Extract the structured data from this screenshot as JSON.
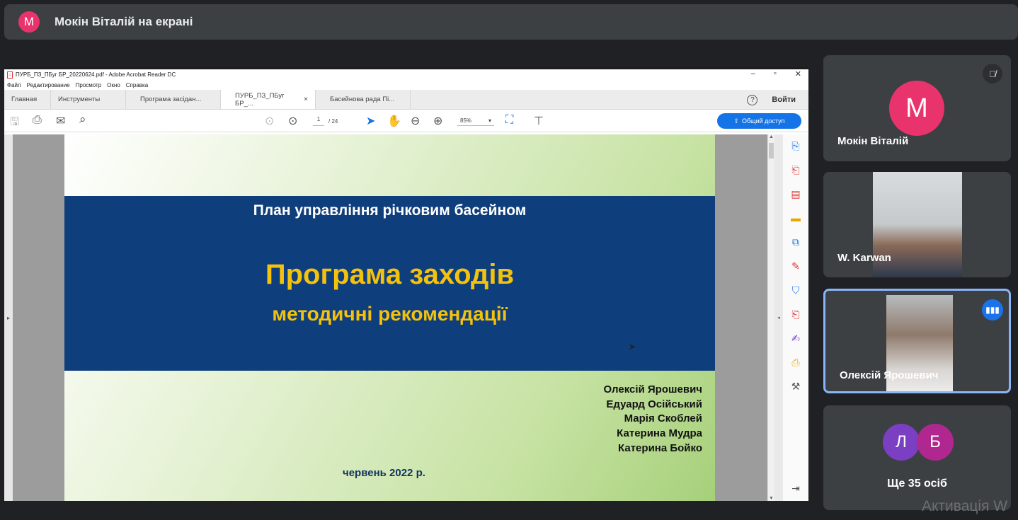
{
  "banner": {
    "avatar_letter": "M",
    "presenter_text": "Мокін Віталій на екрані"
  },
  "acrobat": {
    "window_title": "ПУРБ_ПЗ_ПБуг БР_20220624.pdf - Adobe Acrobat Reader DC",
    "menu": [
      "Файл",
      "Редактирование",
      "Просмотр",
      "Окно",
      "Справка"
    ],
    "tabs": [
      {
        "label": "Главная"
      },
      {
        "label": "Инструменты"
      },
      {
        "label": "Програма засідан..."
      },
      {
        "label": "ПУРБ_ПЗ_ПБуг БР_..."
      },
      {
        "label": "Басейнова рада Пі..."
      }
    ],
    "tab_close": "×",
    "help": "?",
    "login": "Войти",
    "page_current": "1",
    "page_total": "/ 24",
    "zoom": "85%",
    "zoom_caret": "▾",
    "share": "Общий доступ"
  },
  "slide": {
    "subtitle": "План управління річковим басейном",
    "title": "Програма заходів",
    "title2": "методичні рекомендації",
    "authors": [
      "Олексій Ярошевич",
      "Едуард Осійський",
      "Марія Скоблей",
      "Катерина Мудра",
      "Катерина Бойко"
    ],
    "date": "червень 2022 р."
  },
  "participants": [
    {
      "name": "Мокін Віталій",
      "avatar_letter": "M",
      "avatar_color": "#e8336c",
      "muted": true
    },
    {
      "name": "W. Karwan",
      "video": true
    },
    {
      "name": "Олексій Ярошевич",
      "video": true,
      "speaking": true
    },
    {
      "more_text": "Ще 35 осіб",
      "avatars": [
        {
          "letter": "Л",
          "color": "#7b3fc4"
        },
        {
          "letter": "Б",
          "color": "#b0288f"
        }
      ]
    }
  ],
  "watermark": "Активація W"
}
